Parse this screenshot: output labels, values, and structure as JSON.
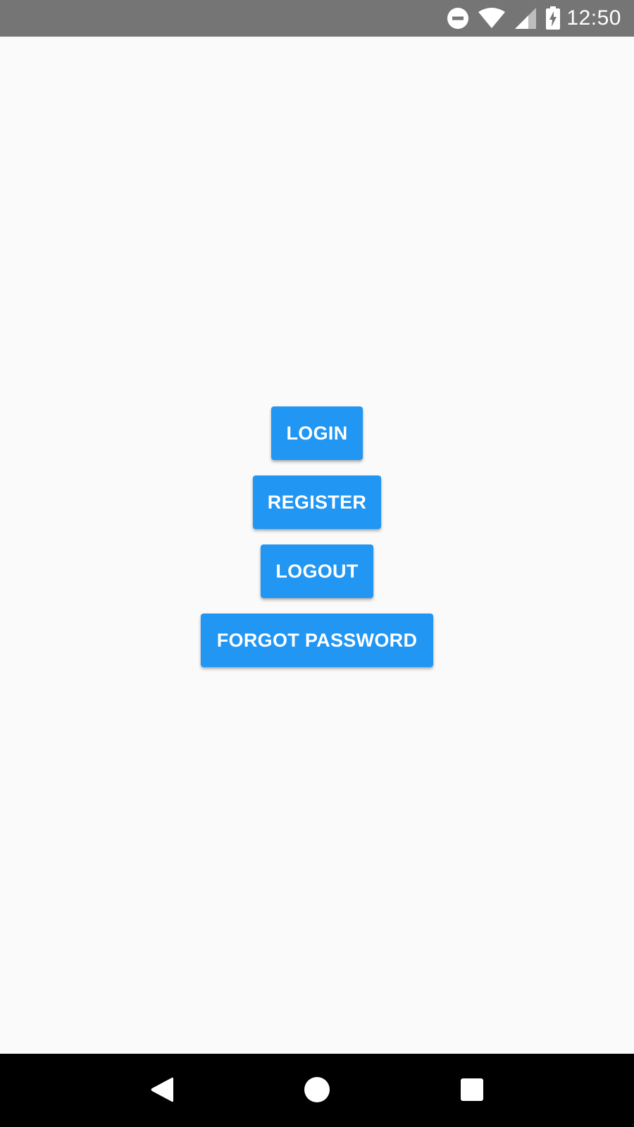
{
  "status_bar": {
    "time": "12:50",
    "icons": [
      "do-not-disturb-icon",
      "wifi-icon",
      "cell-signal-icon",
      "battery-charging-icon"
    ]
  },
  "buttons": {
    "login": "LOGIN",
    "register": "REGISTER",
    "logout": "LOGOUT",
    "forgot_password": "FORGOT PASSWORD"
  },
  "nav_bar": {
    "icons": [
      "back-icon",
      "home-icon",
      "recents-icon"
    ]
  },
  "colors": {
    "status_bar_bg": "#757575",
    "background": "#fafafa",
    "button_bg": "#2196f3",
    "button_text": "#ffffff",
    "nav_bar_bg": "#000000"
  }
}
